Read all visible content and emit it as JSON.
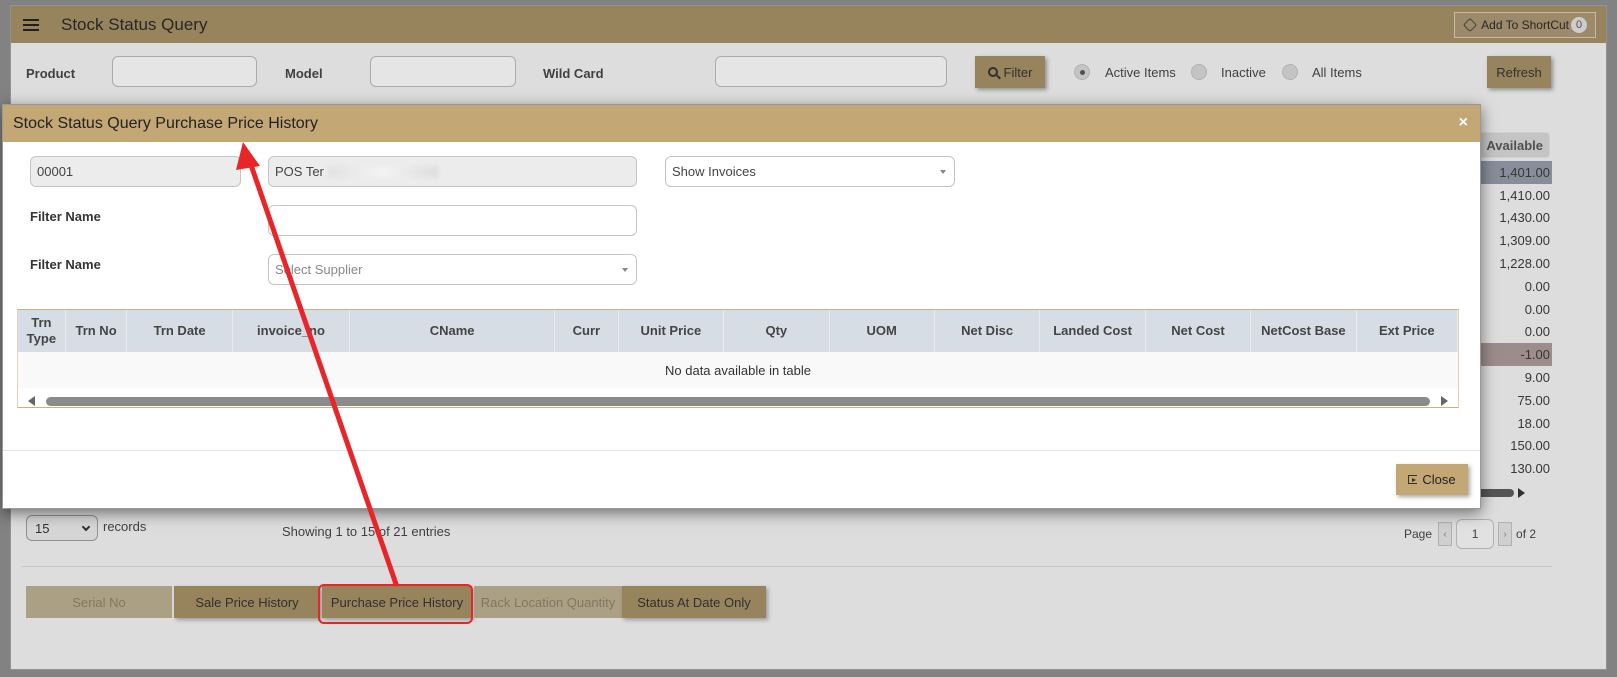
{
  "page": {
    "title": "Stock Status Query",
    "shortcut": {
      "label": "Add To ShortCut",
      "badge": "0"
    },
    "filters": {
      "product_label": "Product",
      "model_label": "Model",
      "wildcard_label": "Wild Card",
      "filter_button": "Filter",
      "radio_active": "Active Items",
      "radio_inactive": "Inactive",
      "radio_all": "All Items",
      "refresh_button": "Refresh"
    },
    "available_header": "Available",
    "available_values": [
      "1,401.00",
      "1,410.00",
      "1,430.00",
      "1,309.00",
      "1,228.00",
      "0.00",
      "0.00",
      "0.00",
      "-1.00",
      "9.00",
      "75.00",
      "18.00",
      "150.00",
      "130.00"
    ],
    "records_select": "15",
    "records_label": "records",
    "showing": "Showing 1 to 15 of 21 entries",
    "pager": {
      "page_label": "Page",
      "prev": "‹",
      "current": "1",
      "next": "›",
      "of_label": "of 2"
    },
    "bottom_buttons": {
      "serial_no": "Serial No",
      "sale_price_history": "Sale Price History",
      "purchase_price_history": "Purchase Price History",
      "rack_location_quantity": "Rack Location Quantity",
      "status_at_date_only": "Status At Date Only"
    }
  },
  "modal": {
    "title": "Stock Status Query Purchase Price History",
    "close_x": "×",
    "code_value": "00001",
    "name_value": "POS Ter",
    "show_invoices": "Show Invoices",
    "filter_name_label_1": "Filter Name",
    "filter_name_label_2": "Filter Name",
    "supplier_placeholder": "Select Supplier",
    "table": {
      "columns": [
        "Trn Type",
        "Trn No",
        "Trn Date",
        "invoice_no",
        "CName",
        "Curr",
        "Unit Price",
        "Qty",
        "UOM",
        "Net Disc",
        "Landed Cost",
        "Net Cost",
        "NetCost Base",
        "Ext Price"
      ],
      "empty_message": "No data available in table"
    },
    "close_button": "Close"
  },
  "colors": {
    "header": "#a08c63",
    "modal_header": "#c3a775",
    "annotation": "#e8262a"
  }
}
